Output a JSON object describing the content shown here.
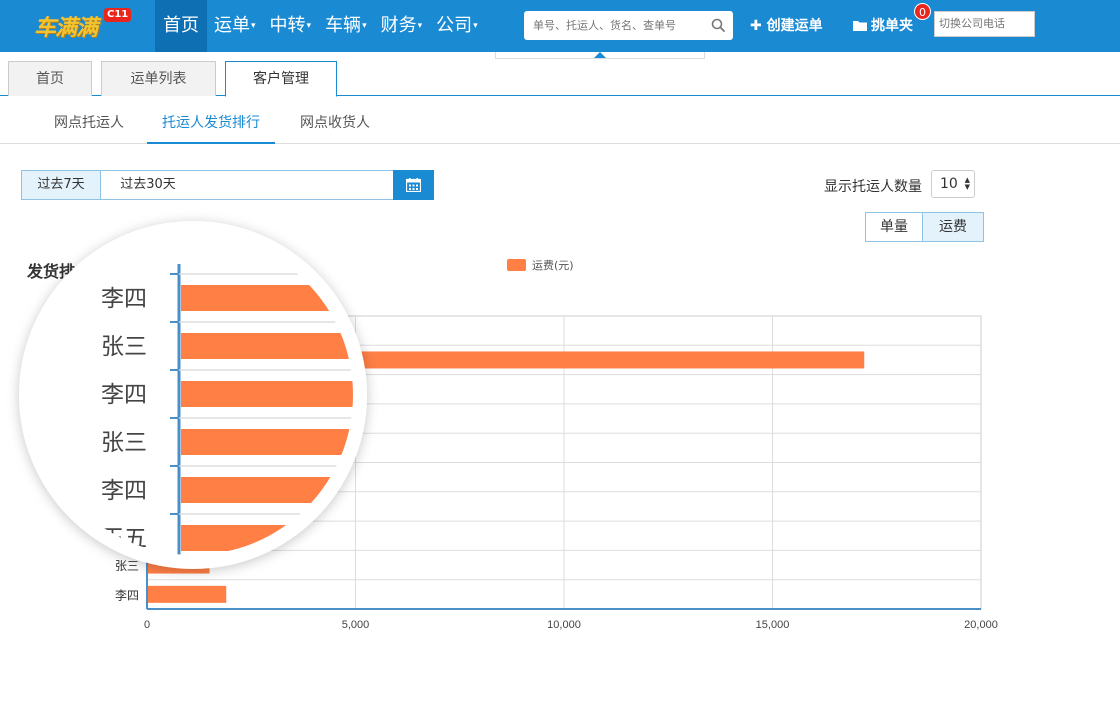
{
  "app": {
    "logo_text": "车满满",
    "badge": "C11"
  },
  "nav": {
    "items": [
      {
        "label": "首页",
        "caret": false,
        "active": true
      },
      {
        "label": "运单",
        "caret": true,
        "active": false
      },
      {
        "label": "中转",
        "caret": true,
        "active": false
      },
      {
        "label": "车辆",
        "caret": true,
        "active": false
      },
      {
        "label": "财务",
        "caret": true,
        "active": false
      },
      {
        "label": "公司",
        "caret": true,
        "active": false
      }
    ],
    "caret_glyph": "▾",
    "search_placeholder": "单号、托运人、货名、查单号",
    "create_label": "✚ 创建运单",
    "folder_label": "挑单夹",
    "folder_count": "0",
    "phone_placeholder": "切换公司电话"
  },
  "tabs": [
    {
      "label": "首页"
    },
    {
      "label": "运单列表"
    },
    {
      "label": "客户管理"
    }
  ],
  "subtabs": [
    {
      "label": "网点托运人"
    },
    {
      "label": "托运人发货排行"
    },
    {
      "label": "网点收货人"
    }
  ],
  "filters": {
    "range_7": "过去7天",
    "range_30": "过去30天",
    "count_label": "显示托运人数量",
    "count_value": "10",
    "metric_count": "单量",
    "metric_fee": "运费"
  },
  "chart": {
    "title": "发货排"
  },
  "colors": {
    "brand": "#1a8ad3",
    "bar": "#ff7f45",
    "badge": "#e8261d"
  },
  "chart_data": {
    "type": "bar",
    "orientation": "horizontal",
    "categories": [
      "李四",
      "张三",
      "李四",
      "张三",
      "李四",
      "王五",
      "张三",
      "李四",
      "张三",
      "李四"
    ],
    "series": [
      {
        "name": "运费(元)",
        "values": [
          3000,
          17200,
          4200,
          3800,
          3600,
          3200,
          2100,
          1700,
          1500,
          1900
        ]
      }
    ],
    "xlim": [
      0,
      20000
    ],
    "xticks": [
      "0",
      "5,000",
      "10,000",
      "15,000",
      "20,000"
    ],
    "grid": true,
    "legend": "top-center"
  }
}
